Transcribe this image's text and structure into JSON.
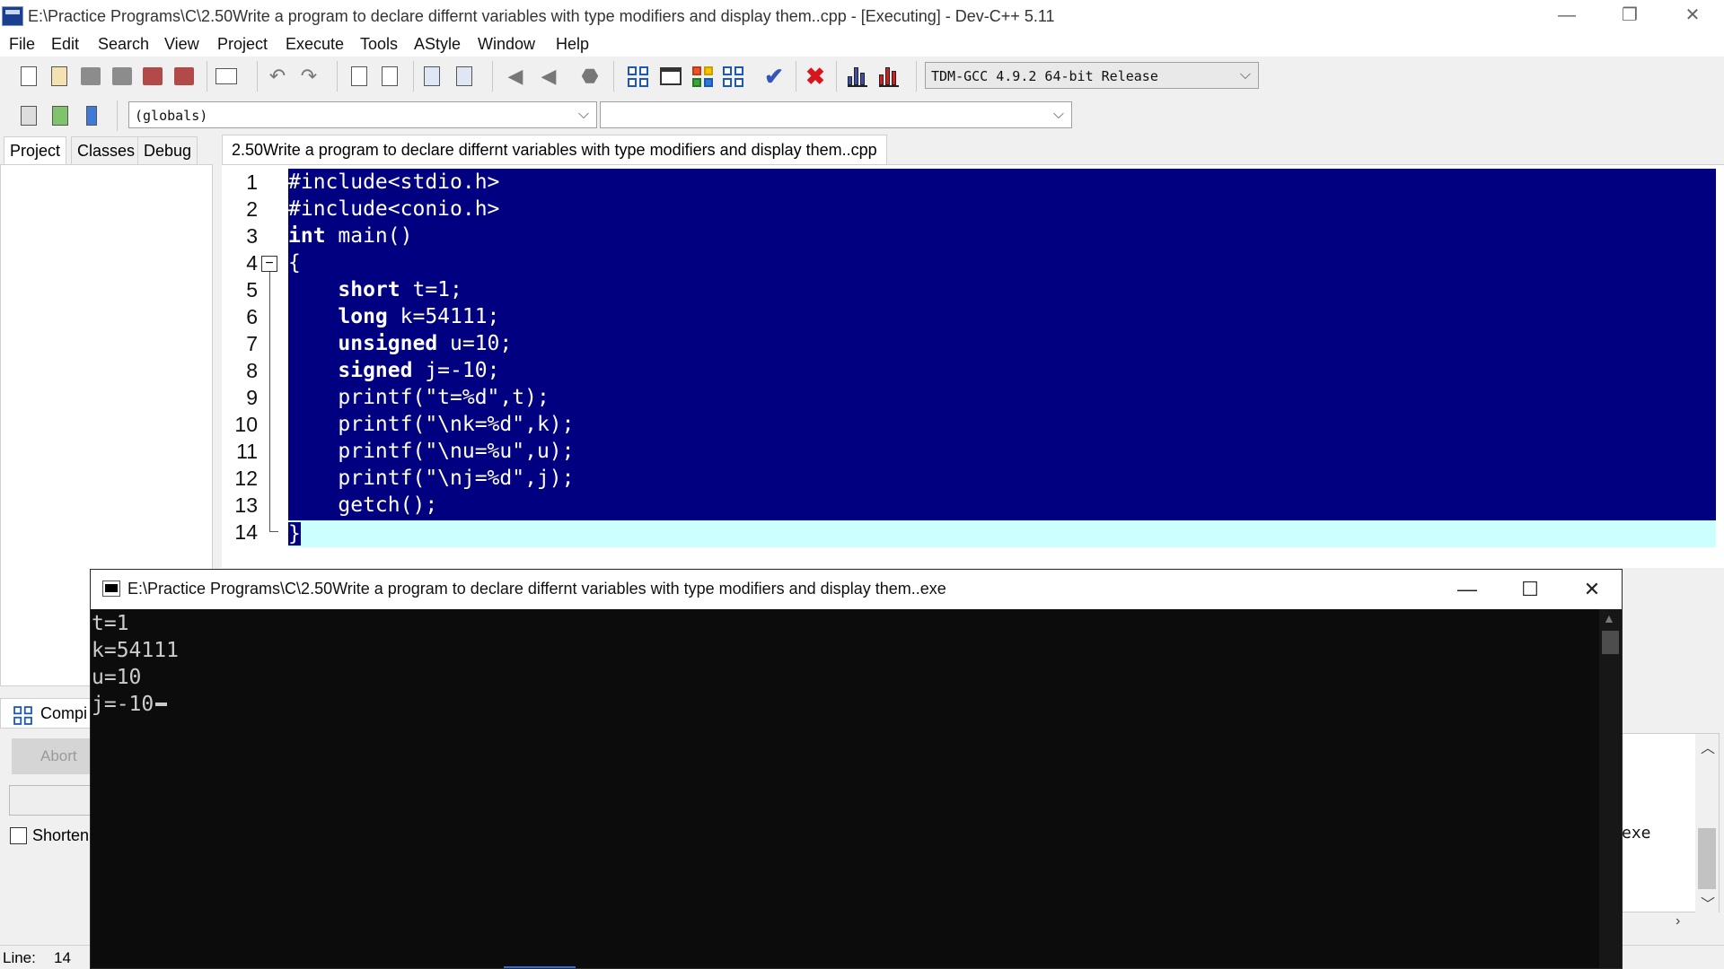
{
  "window": {
    "title": "E:\\Practice Programs\\C\\2.50Write a program to declare differnt variables with type modifiers and display them..cpp - [Executing] - Dev-C++ 5.11"
  },
  "menu": [
    "File",
    "Edit",
    "Search",
    "View",
    "Project",
    "Execute",
    "Tools",
    "AStyle",
    "Window",
    "Help"
  ],
  "toolbar": {
    "compiler": "TDM-GCC 4.9.2 64-bit Release",
    "scope": "(globals)",
    "member": ""
  },
  "left_tabs": [
    "Project",
    "Classes",
    "Debug"
  ],
  "editor": {
    "file_tab": "2.50Write a program to declare differnt variables with type modifiers and display them..cpp",
    "line_numbers": [
      "1",
      "2",
      "3",
      "4",
      "5",
      "6",
      "7",
      "8",
      "9",
      "10",
      "11",
      "12",
      "13",
      "14"
    ],
    "lines": [
      {
        "kw": "",
        "rest": "#include<stdio.h>"
      },
      {
        "kw": "",
        "rest": "#include<conio.h>"
      },
      {
        "kw": "int",
        "rest": " main()"
      },
      {
        "kw": "",
        "rest": "{"
      },
      {
        "kw": "    short",
        "rest": " t=1;"
      },
      {
        "kw": "    long",
        "rest": " k=54111;"
      },
      {
        "kw": "    unsigned",
        "rest": " u=10;"
      },
      {
        "kw": "    signed",
        "rest": " j=-10;"
      },
      {
        "kw": "",
        "rest": "    printf(\"t=%d\",t);"
      },
      {
        "kw": "",
        "rest": "    printf(\"\\nk=%d\",k);"
      },
      {
        "kw": "",
        "rest": "    printf(\"\\nu=%u\",u);"
      },
      {
        "kw": "",
        "rest": "    printf(\"\\nj=%d\",j);"
      },
      {
        "kw": "",
        "rest": "    getch();"
      },
      {
        "kw": "",
        "rest": "}"
      }
    ]
  },
  "bottom_panel": {
    "tab_label": "Compi",
    "abort_label": "Abort",
    "shorten_label": "Shorten",
    "log_fragment": "exe"
  },
  "status": {
    "line_label": "Line:",
    "line_value": "14"
  },
  "console": {
    "title": "E:\\Practice Programs\\C\\2.50Write a program to declare differnt variables with type modifiers and display them..exe",
    "output": [
      "t=1",
      "k=54111",
      "u=10",
      "j=-10"
    ]
  },
  "icons": {
    "app": "devcpp-icon",
    "console": "console-icon"
  },
  "colors": {
    "selection": "#000080",
    "current_line": "#ccffff",
    "console_bg": "#0c0c0c",
    "console_text": "#cccccc"
  }
}
